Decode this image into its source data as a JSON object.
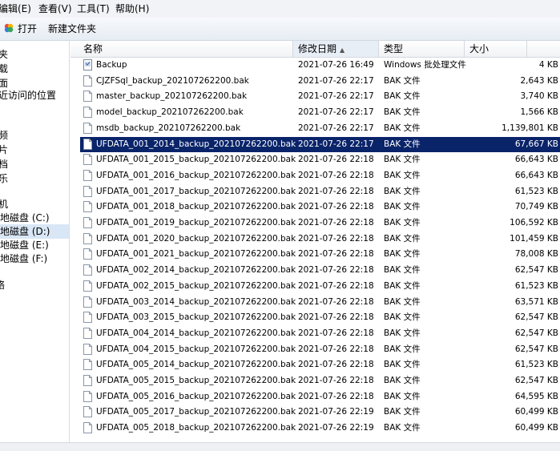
{
  "menu": [
    "编辑(E)",
    "查看(V)",
    "工具(T)",
    "帮助(H)"
  ],
  "toolbar": {
    "open_label": "打开",
    "new_folder_label": "新建文件夹"
  },
  "sidebar": {
    "items": [
      "夹",
      "载",
      "面",
      "近访问的位置",
      "频",
      "片",
      "档",
      "乐",
      "机",
      "地磁盘 (C:)",
      "地磁盘 (D:)",
      "地磁盘 (E:)",
      "地磁盘 (F:)",
      "络"
    ],
    "selected_index": 10
  },
  "columns": {
    "name": "名称",
    "date": "修改日期",
    "type": "类型",
    "size": "大小"
  },
  "files": [
    {
      "name": "Backup",
      "date": "2021-07-26 16:49",
      "type": "Windows 批处理文件",
      "size": "4 KB",
      "icon": "batch-file-icon"
    },
    {
      "name": "CJZFSql_backup_202107262200.bak",
      "date": "2021-07-26 22:17",
      "type": "BAK 文件",
      "size": "2,643 KB",
      "icon": "file-icon"
    },
    {
      "name": "master_backup_202107262200.bak",
      "date": "2021-07-26 22:17",
      "type": "BAK 文件",
      "size": "3,740 KB",
      "icon": "file-icon"
    },
    {
      "name": "model_backup_202107262200.bak",
      "date": "2021-07-26 22:17",
      "type": "BAK 文件",
      "size": "1,566 KB",
      "icon": "file-icon"
    },
    {
      "name": "msdb_backup_202107262200.bak",
      "date": "2021-07-26 22:17",
      "type": "BAK 文件",
      "size": "1,139,801 KB",
      "icon": "file-icon"
    },
    {
      "name": "UFDATA_001_2014_backup_202107262200.bak",
      "date": "2021-07-26 22:17",
      "type": "BAK 文件",
      "size": "67,667 KB",
      "icon": "file-icon"
    },
    {
      "name": "UFDATA_001_2015_backup_202107262200.bak",
      "date": "2021-07-26 22:18",
      "type": "BAK 文件",
      "size": "66,643 KB",
      "icon": "file-icon"
    },
    {
      "name": "UFDATA_001_2016_backup_202107262200.bak",
      "date": "2021-07-26 22:18",
      "type": "BAK 文件",
      "size": "66,643 KB",
      "icon": "file-icon"
    },
    {
      "name": "UFDATA_001_2017_backup_202107262200.bak",
      "date": "2021-07-26 22:18",
      "type": "BAK 文件",
      "size": "61,523 KB",
      "icon": "file-icon"
    },
    {
      "name": "UFDATA_001_2018_backup_202107262200.bak",
      "date": "2021-07-26 22:18",
      "type": "BAK 文件",
      "size": "70,749 KB",
      "icon": "file-icon"
    },
    {
      "name": "UFDATA_001_2019_backup_202107262200.bak",
      "date": "2021-07-26 22:18",
      "type": "BAK 文件",
      "size": "106,592 KB",
      "icon": "file-icon"
    },
    {
      "name": "UFDATA_001_2020_backup_202107262200.bak",
      "date": "2021-07-26 22:18",
      "type": "BAK 文件",
      "size": "101,459 KB",
      "icon": "file-icon"
    },
    {
      "name": "UFDATA_001_2021_backup_202107262200.bak",
      "date": "2021-07-26 22:18",
      "type": "BAK 文件",
      "size": "78,008 KB",
      "icon": "file-icon"
    },
    {
      "name": "UFDATA_002_2014_backup_202107262200.bak",
      "date": "2021-07-26 22:18",
      "type": "BAK 文件",
      "size": "62,547 KB",
      "icon": "file-icon"
    },
    {
      "name": "UFDATA_002_2015_backup_202107262200.bak",
      "date": "2021-07-26 22:18",
      "type": "BAK 文件",
      "size": "61,523 KB",
      "icon": "file-icon"
    },
    {
      "name": "UFDATA_003_2014_backup_202107262200.bak",
      "date": "2021-07-26 22:18",
      "type": "BAK 文件",
      "size": "63,571 KB",
      "icon": "file-icon"
    },
    {
      "name": "UFDATA_003_2015_backup_202107262200.bak",
      "date": "2021-07-26 22:18",
      "type": "BAK 文件",
      "size": "62,547 KB",
      "icon": "file-icon"
    },
    {
      "name": "UFDATA_004_2014_backup_202107262200.bak",
      "date": "2021-07-26 22:18",
      "type": "BAK 文件",
      "size": "62,547 KB",
      "icon": "file-icon"
    },
    {
      "name": "UFDATA_004_2015_backup_202107262200.bak",
      "date": "2021-07-26 22:18",
      "type": "BAK 文件",
      "size": "62,547 KB",
      "icon": "file-icon"
    },
    {
      "name": "UFDATA_005_2014_backup_202107262200.bak",
      "date": "2021-07-26 22:18",
      "type": "BAK 文件",
      "size": "61,523 KB",
      "icon": "file-icon"
    },
    {
      "name": "UFDATA_005_2015_backup_202107262200.bak",
      "date": "2021-07-26 22:18",
      "type": "BAK 文件",
      "size": "62,547 KB",
      "icon": "file-icon"
    },
    {
      "name": "UFDATA_005_2016_backup_202107262200.bak",
      "date": "2021-07-26 22:18",
      "type": "BAK 文件",
      "size": "64,595 KB",
      "icon": "file-icon"
    },
    {
      "name": "UFDATA_005_2017_backup_202107262200.bak",
      "date": "2021-07-26 22:19",
      "type": "BAK 文件",
      "size": "60,499 KB",
      "icon": "file-icon"
    },
    {
      "name": "UFDATA_005_2018_backup_202107262200.bak",
      "date": "2021-07-26 22:19",
      "type": "BAK 文件",
      "size": "60,499 KB",
      "icon": "file-icon"
    }
  ],
  "selected_file_index": 5,
  "colors": {
    "selection": "#0a246a",
    "nav_selection": "#d9e6f5"
  }
}
